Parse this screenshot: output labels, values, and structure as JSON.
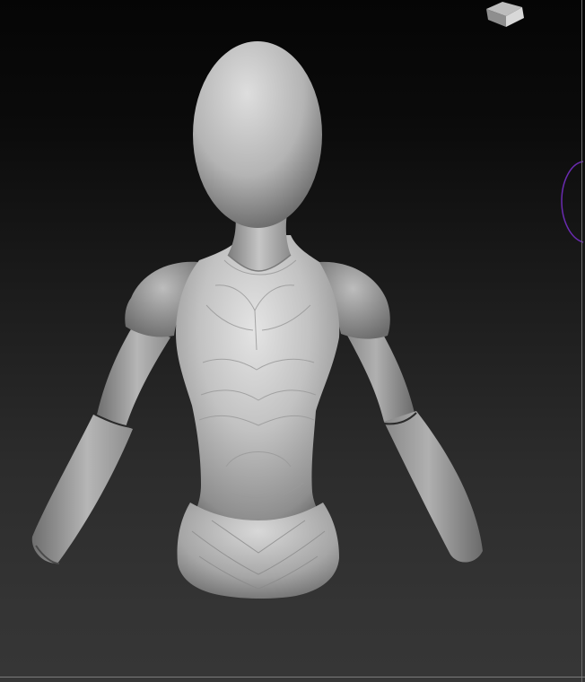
{
  "viewport": {
    "background_top": "#050505",
    "background_bottom": "#363636"
  },
  "model": {
    "icon": "mannequin-bust-sculpt",
    "base_color": "#a8a8a8"
  },
  "navigation_cube": {
    "icon": "view-cube-icon"
  },
  "transform_gizmo": {
    "icon": "rotation-ring-icon",
    "color": "#6a2bb0"
  }
}
